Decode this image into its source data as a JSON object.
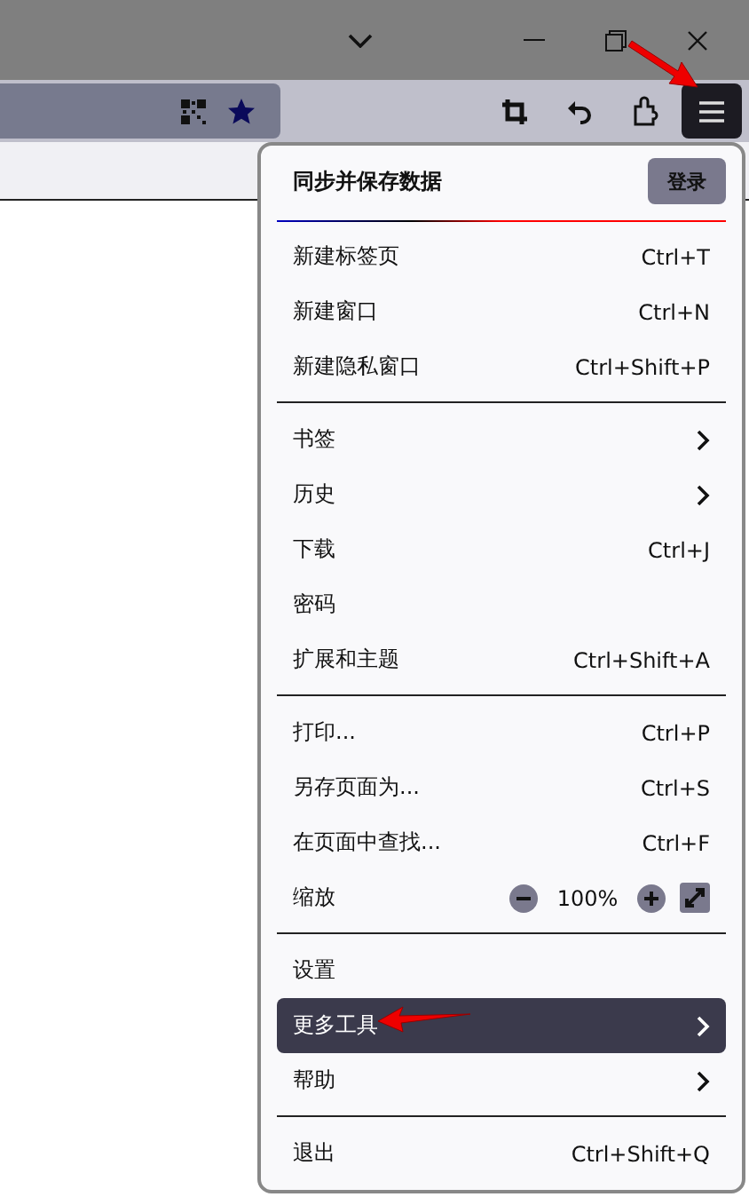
{
  "menu": {
    "header": {
      "title": "同步并保存数据",
      "button": "登录"
    },
    "sections": [
      [
        {
          "kind": "item",
          "label": "新建标签页",
          "shortcut": "Ctrl+T",
          "selected": false
        },
        {
          "kind": "item",
          "label": "新建窗口",
          "shortcut": "Ctrl+N",
          "selected": false
        },
        {
          "kind": "item",
          "label": "新建隐私窗口",
          "shortcut": "Ctrl+Shift+P",
          "selected": false
        }
      ],
      [
        {
          "kind": "submenu",
          "label": "书签",
          "selected": false
        },
        {
          "kind": "submenu",
          "label": "历史",
          "selected": false
        },
        {
          "kind": "item",
          "label": "下载",
          "shortcut": "Ctrl+J",
          "selected": false
        },
        {
          "kind": "item",
          "label": "密码",
          "selected": false
        },
        {
          "kind": "item",
          "label": "扩展和主题",
          "shortcut": "Ctrl+Shift+A",
          "selected": false
        }
      ],
      [
        {
          "kind": "item",
          "label": "打印...",
          "shortcut": "Ctrl+P",
          "selected": false
        },
        {
          "kind": "item",
          "label": "另存页面为...",
          "shortcut": "Ctrl+S",
          "selected": false
        },
        {
          "kind": "item",
          "label": "在页面中查找...",
          "shortcut": "Ctrl+F",
          "selected": false
        },
        {
          "kind": "zoom",
          "label": "缩放",
          "value": "100%",
          "selected": false
        }
      ],
      [
        {
          "kind": "item",
          "label": "设置",
          "selected": false
        },
        {
          "kind": "submenu",
          "label": "更多工具",
          "selected": true
        },
        {
          "kind": "submenu",
          "label": "帮助",
          "selected": false
        }
      ],
      [
        {
          "kind": "item",
          "label": "退出",
          "shortcut": "Ctrl+Shift+Q",
          "selected": false
        }
      ]
    ]
  }
}
